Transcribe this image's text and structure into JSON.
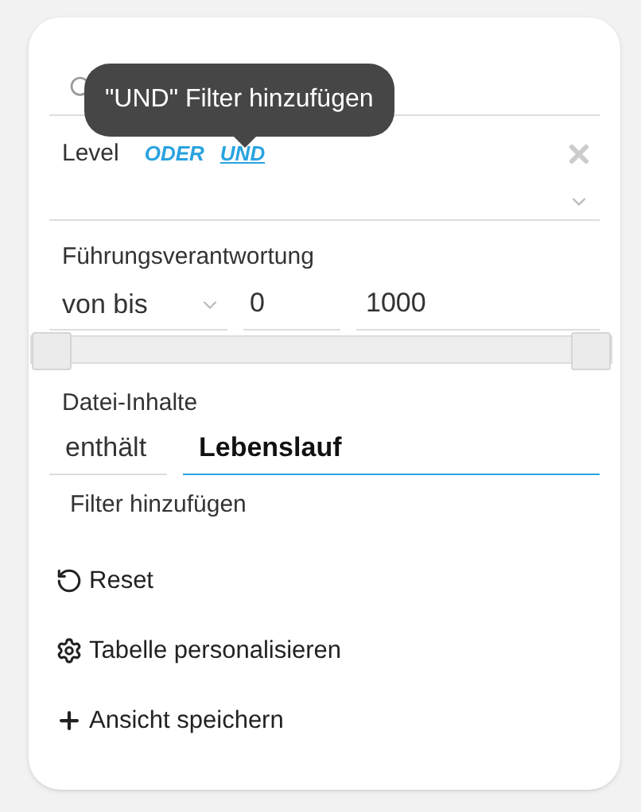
{
  "tooltip": {
    "text": "\"UND\" Filter hinzufügen"
  },
  "level_filter": {
    "label": "Level",
    "modes": [
      {
        "label": "ODER",
        "selected": false
      },
      {
        "label": "UND",
        "selected": true
      }
    ]
  },
  "fuehrung": {
    "label": "Führungsverantwortung",
    "operator": "von bis",
    "from": "0",
    "to": "1000",
    "thumbs": [
      {
        "level": 0
      },
      {
        "level": 1
      }
    ]
  },
  "datei": {
    "label": "Datei-Inhalte",
    "operator": "enthält",
    "value": "Lebenslauf"
  },
  "add_filter": "Filter hinzufügen",
  "actions": [
    {
      "kind": "reset",
      "label": "Reset"
    },
    {
      "kind": "settings",
      "label": "Tabelle personalisieren"
    },
    {
      "kind": "add",
      "label": "Ansicht speichern"
    }
  ]
}
